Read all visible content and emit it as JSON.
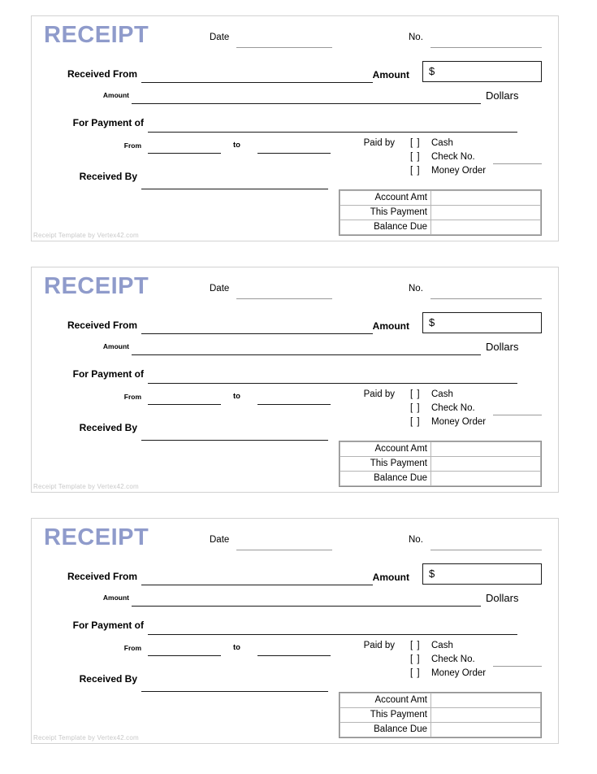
{
  "document": {
    "type": "receipt-template",
    "copies": 3,
    "title_color": "#8f9bcb",
    "background": "#ffffff"
  },
  "receipt": {
    "title": "RECEIPT",
    "date_label": "Date",
    "no_label": "No.",
    "received_from_label": "Received From",
    "amount_label": "Amount",
    "amount_currency_symbol": "$",
    "amount_words_label": "Amount",
    "dollars_label": "Dollars",
    "for_payment_of_label": "For Payment of",
    "from_label": "From",
    "to_label": "to",
    "received_by_label": "Received By",
    "paid_by": {
      "label": "Paid by",
      "checkbox_glyph": "[  ]",
      "options": [
        {
          "label": "Cash",
          "has_fill_line": false
        },
        {
          "label": "Check No.",
          "has_fill_line": true
        },
        {
          "label": "Money Order",
          "has_fill_line": false
        }
      ]
    },
    "amount_table": {
      "rows": [
        {
          "label": "Account Amt",
          "value": ""
        },
        {
          "label": "This Payment",
          "value": ""
        },
        {
          "label": "Balance Due",
          "value": ""
        }
      ]
    },
    "credit": "Receipt Template by Vertex42.com",
    "fields": {
      "date_value": "",
      "no_value": "",
      "received_from_value": "",
      "amount_value": "",
      "amount_words_value": "",
      "for_payment_of_value": "",
      "from_value": "",
      "to_value": "",
      "check_no_value": "",
      "received_by_value": ""
    }
  }
}
